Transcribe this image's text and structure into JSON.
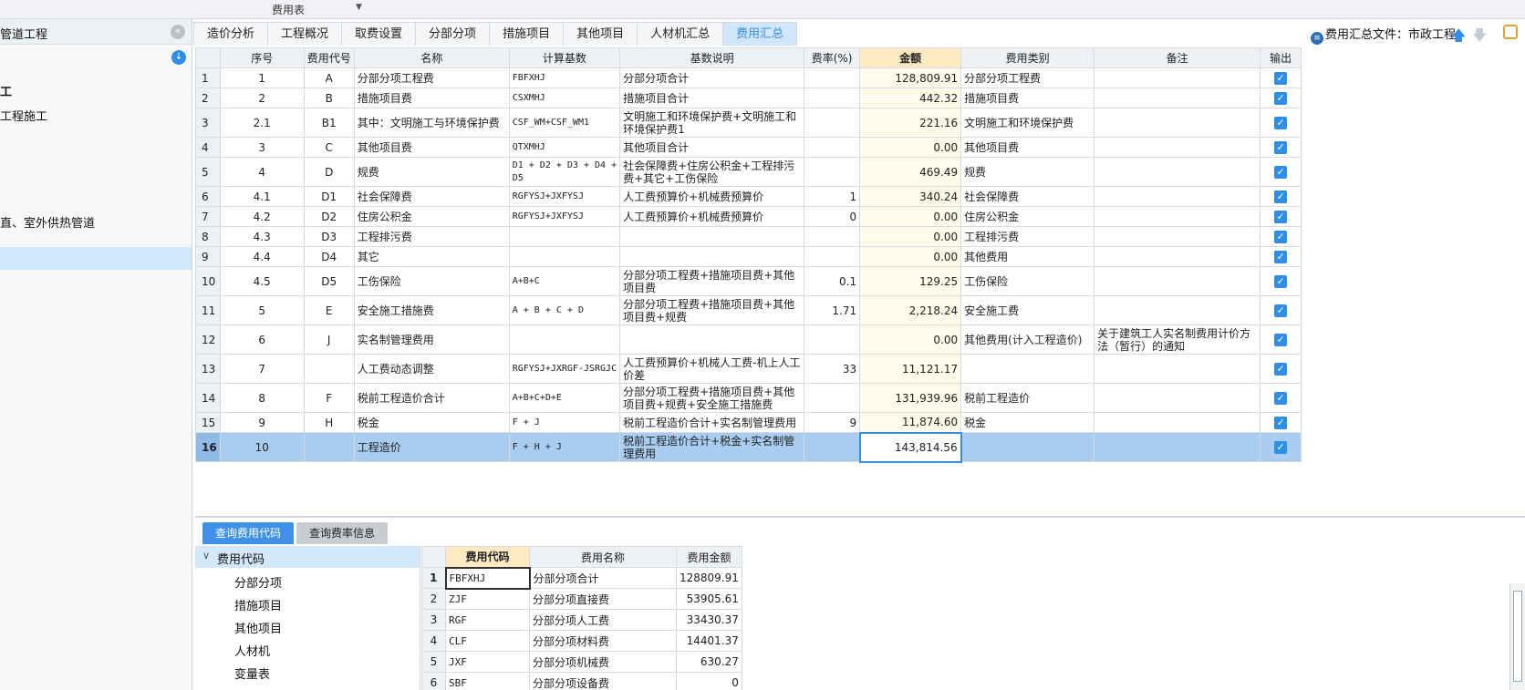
{
  "top_menu": {
    "label": "费用表"
  },
  "sidebar": {
    "title": "管道工程",
    "items": [
      "工",
      "工程施工",
      "直、室外供热管道"
    ]
  },
  "tabs": [
    "造价分析",
    "工程概况",
    "取费设置",
    "分部分项",
    "措施项目",
    "其他项目",
    "人材机汇总",
    "费用汇总"
  ],
  "active_tab": "费用汇总",
  "file_label": "费用汇总文件：市政工程",
  "main_table": {
    "columns": [
      "序号",
      "费用代号",
      "名称",
      "计算基数",
      "基数说明",
      "费率(%)",
      "金额",
      "费用类别",
      "备注",
      "输出"
    ],
    "rows": [
      {
        "n": "1",
        "seq": "1",
        "code": "A",
        "name": "分部分项工程费",
        "base": "FBFXHJ",
        "desc": "分部分项合计",
        "rate": "",
        "amount": "128,809.91",
        "cat": "分部分项工程费",
        "note": ""
      },
      {
        "n": "2",
        "seq": "2",
        "code": "B",
        "name": "措施项目费",
        "base": "CSXMHJ",
        "desc": "措施项目合计",
        "rate": "",
        "amount": "442.32",
        "cat": "措施项目费",
        "note": ""
      },
      {
        "n": "3",
        "seq": "2.1",
        "code": "B1",
        "name": "其中：文明施工与环境保护费",
        "base": "CSF_WM+CSF_WM1",
        "desc": "文明施工和环境保护费+文明施工和环境保护费1",
        "rate": "",
        "amount": "221.16",
        "cat": "文明施工和环境保护费",
        "note": ""
      },
      {
        "n": "4",
        "seq": "3",
        "code": "C",
        "name": "其他项目费",
        "base": "QTXMHJ",
        "desc": "其他项目合计",
        "rate": "",
        "amount": "0.00",
        "cat": "其他项目费",
        "note": ""
      },
      {
        "n": "5",
        "seq": "4",
        "code": "D",
        "name": "规费",
        "base": "D1 + D2 + D3 + D4 + D5",
        "desc": "社会保障费+住房公积金+工程排污费+其它+工伤保险",
        "rate": "",
        "amount": "469.49",
        "cat": "规费",
        "note": ""
      },
      {
        "n": "6",
        "seq": "4.1",
        "code": "D1",
        "name": "社会保障费",
        "base": "RGFYSJ+JXFYSJ",
        "desc": "人工费预算价+机械费预算价",
        "rate": "1",
        "amount": "340.24",
        "cat": "社会保障费",
        "note": ""
      },
      {
        "n": "7",
        "seq": "4.2",
        "code": "D2",
        "name": "住房公积金",
        "base": "RGFYSJ+JXFYSJ",
        "desc": "人工费预算价+机械费预算价",
        "rate": "0",
        "amount": "0.00",
        "cat": "住房公积金",
        "note": ""
      },
      {
        "n": "8",
        "seq": "4.3",
        "code": "D3",
        "name": "工程排污费",
        "base": "",
        "desc": "",
        "rate": "",
        "amount": "0.00",
        "cat": "工程排污费",
        "note": ""
      },
      {
        "n": "9",
        "seq": "4.4",
        "code": "D4",
        "name": "其它",
        "base": "",
        "desc": "",
        "rate": "",
        "amount": "0.00",
        "cat": "其他费用",
        "note": ""
      },
      {
        "n": "10",
        "seq": "4.5",
        "code": "D5",
        "name": "工伤保险",
        "base": "A+B+C",
        "desc": "分部分项工程费+措施项目费+其他项目费",
        "rate": "0.1",
        "amount": "129.25",
        "cat": "工伤保险",
        "note": ""
      },
      {
        "n": "11",
        "seq": "5",
        "code": "E",
        "name": "安全施工措施费",
        "base": "A + B + C + D",
        "desc": "分部分项工程费+措施项目费+其他项目费+规费",
        "rate": "1.71",
        "amount": "2,218.24",
        "cat": "安全施工费",
        "note": ""
      },
      {
        "n": "12",
        "seq": "6",
        "code": "J",
        "name": "实名制管理费用",
        "base": "",
        "desc": "",
        "rate": "",
        "amount": "0.00",
        "cat": "其他费用(计入工程造价)",
        "note": "关于建筑工人实名制费用计价方法（暂行）的通知"
      },
      {
        "n": "13",
        "seq": "7",
        "code": "",
        "name": "人工费动态调整",
        "base": "RGFYSJ+JXRGF-JSRGJC",
        "desc": "人工费预算价+机械人工费-机上人工价差",
        "rate": "33",
        "amount": "11,121.17",
        "cat": "",
        "note": ""
      },
      {
        "n": "14",
        "seq": "8",
        "code": "F",
        "name": "税前工程造价合计",
        "base": "A+B+C+D+E",
        "desc": "分部分项工程费+措施项目费+其他项目费+规费+安全施工措施费",
        "rate": "",
        "amount": "131,939.96",
        "cat": "税前工程造价",
        "note": ""
      },
      {
        "n": "15",
        "seq": "9",
        "code": "H",
        "name": "税金",
        "base": "F + J",
        "desc": "税前工程造价合计+实名制管理费用",
        "rate": "9",
        "amount": "11,874.60",
        "cat": "税金",
        "note": ""
      },
      {
        "n": "16",
        "seq": "10",
        "code": "",
        "name": "工程造价",
        "base": "F + H + J",
        "desc": "税前工程造价合计+税金+实名制管理费用",
        "rate": "",
        "amount": "143,814.56",
        "cat": "",
        "note": ""
      }
    ]
  },
  "bottom_tabs": [
    "查询费用代码",
    "查询费率信息"
  ],
  "tree": {
    "root": "费用代码",
    "items": [
      "分部分项",
      "措施项目",
      "其他项目",
      "人材机",
      "变量表"
    ]
  },
  "code_table": {
    "columns": [
      "费用代码",
      "费用名称",
      "费用金额"
    ],
    "rows": [
      {
        "n": "1",
        "code": "FBFXHJ",
        "name": "分部分项合计",
        "amount": "128809.91"
      },
      {
        "n": "2",
        "code": "ZJF",
        "name": "分部分项直接费",
        "amount": "53905.61"
      },
      {
        "n": "3",
        "code": "RGF",
        "name": "分部分项人工费",
        "amount": "33430.37"
      },
      {
        "n": "4",
        "code": "CLF",
        "name": "分部分项材料费",
        "amount": "14401.37"
      },
      {
        "n": "5",
        "code": "JXF",
        "name": "分部分项机械费",
        "amount": "630.27"
      },
      {
        "n": "6",
        "code": "SBF",
        "name": "分部分项设备费",
        "amount": "0"
      }
    ]
  },
  "colors": {
    "accent": "#2f8fe8",
    "selected_row": "#a9cdf1",
    "amount_header": "#fde9c2"
  },
  "icons": [
    "collapse-icon",
    "download-icon",
    "file-icon",
    "arrow-up-icon",
    "arrow-down-icon",
    "tool-icon",
    "checkbox-icon",
    "chevron-down-icon"
  ]
}
